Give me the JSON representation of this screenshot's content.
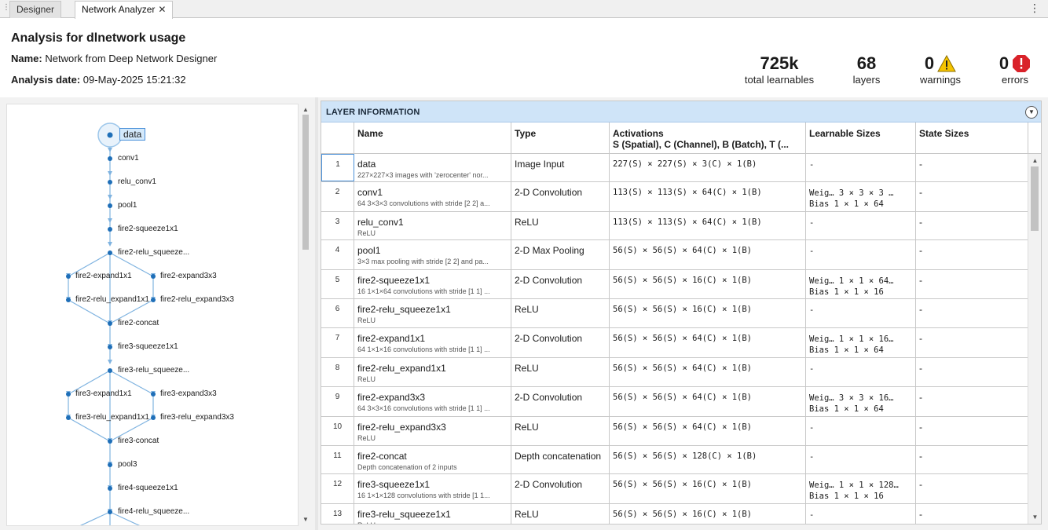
{
  "tabs": [
    {
      "label": "Designer",
      "active": false
    },
    {
      "label": "Network Analyzer",
      "active": true,
      "closable": true
    }
  ],
  "header": {
    "title": "Analysis for dlnetwork usage",
    "name_label": "Name:",
    "name_value": "Network from Deep Network Designer",
    "date_label": "Analysis date:",
    "date_value": "09-May-2025 15:21:32"
  },
  "stats": {
    "learnables": {
      "value": "725k",
      "label": "total learnables"
    },
    "layers": {
      "value": "68",
      "label": "layers"
    },
    "warnings": {
      "value": "0",
      "label": "warnings",
      "icon": "warning-icon",
      "color": "#f5c400"
    },
    "errors": {
      "value": "0",
      "label": "errors",
      "icon": "error-icon",
      "color": "#d9222a"
    }
  },
  "graph": {
    "selected": "data",
    "nodes": [
      "data",
      "conv1",
      "relu_conv1",
      "pool1",
      "fire2-squeeze1x1",
      "fire2-relu_squeeze...",
      "fire2-expand1x1",
      "fire2-expand3x3",
      "fire2-relu_expand1x1",
      "fire2-relu_expand3x3",
      "fire2-concat",
      "fire3-squeeze1x1",
      "fire3-relu_squeeze...",
      "fire3-expand1x1",
      "fire3-expand3x3",
      "fire3-relu_expand1x1",
      "fire3-relu_expand3x3",
      "fire3-concat",
      "pool3",
      "fire4-squeeze1x1",
      "fire4-relu_squeeze..."
    ],
    "accent": "#2b7bc1"
  },
  "table": {
    "title": "LAYER INFORMATION",
    "columns": {
      "name": "Name",
      "type": "Type",
      "activations": "Activations",
      "activations_sub": "S (Spatial), C (Channel), B (Batch), T (...",
      "learnable": "Learnable Sizes",
      "state": "State Sizes"
    },
    "rows": [
      {
        "idx": "1",
        "name": "data",
        "desc": "227×227×3 images with 'zerocenter' nor...",
        "type": "Image Input",
        "act": "227(S) × 227(S) × 3(C) × 1(B)",
        "learn1": "-",
        "learn2": "",
        "state": "-"
      },
      {
        "idx": "2",
        "name": "conv1",
        "desc": "64 3×3×3 convolutions with stride [2 2] a...",
        "type": "2-D Convolution",
        "act": "113(S) × 113(S) × 64(C) × 1(B)",
        "learn1": "Weig…  3 × 3 × 3 …",
        "learn2": "Bias   1 × 1 × 64",
        "state": "-"
      },
      {
        "idx": "3",
        "name": "relu_conv1",
        "desc": "ReLU",
        "type": "ReLU",
        "act": "113(S) × 113(S) × 64(C) × 1(B)",
        "learn1": "-",
        "learn2": "",
        "state": "-"
      },
      {
        "idx": "4",
        "name": "pool1",
        "desc": "3×3 max pooling with stride [2 2] and pa...",
        "type": "2-D Max Pooling",
        "act": "56(S) × 56(S) × 64(C) × 1(B)",
        "learn1": "-",
        "learn2": "",
        "state": "-"
      },
      {
        "idx": "5",
        "name": "fire2-squeeze1x1",
        "desc": "16 1×1×64 convolutions with stride [1 1] ...",
        "type": "2-D Convolution",
        "act": "56(S) × 56(S) × 16(C) × 1(B)",
        "learn1": "Weig…  1 × 1 × 64…",
        "learn2": "Bias   1 × 1 × 16",
        "state": "-"
      },
      {
        "idx": "6",
        "name": "fire2-relu_squeeze1x1",
        "desc": "ReLU",
        "type": "ReLU",
        "act": "56(S) × 56(S) × 16(C) × 1(B)",
        "learn1": "-",
        "learn2": "",
        "state": "-"
      },
      {
        "idx": "7",
        "name": "fire2-expand1x1",
        "desc": "64 1×1×16 convolutions with stride [1 1] ...",
        "type": "2-D Convolution",
        "act": "56(S) × 56(S) × 64(C) × 1(B)",
        "learn1": "Weig…  1 × 1 × 16…",
        "learn2": "Bias   1 × 1 × 64",
        "state": "-"
      },
      {
        "idx": "8",
        "name": "fire2-relu_expand1x1",
        "desc": "ReLU",
        "type": "ReLU",
        "act": "56(S) × 56(S) × 64(C) × 1(B)",
        "learn1": "-",
        "learn2": "",
        "state": "-"
      },
      {
        "idx": "9",
        "name": "fire2-expand3x3",
        "desc": "64 3×3×16 convolutions with stride [1 1] ...",
        "type": "2-D Convolution",
        "act": "56(S) × 56(S) × 64(C) × 1(B)",
        "learn1": "Weig…  3 × 3 × 16…",
        "learn2": "Bias   1 × 1 × 64",
        "state": "-"
      },
      {
        "idx": "10",
        "name": "fire2-relu_expand3x3",
        "desc": "ReLU",
        "type": "ReLU",
        "act": "56(S) × 56(S) × 64(C) × 1(B)",
        "learn1": "-",
        "learn2": "",
        "state": "-"
      },
      {
        "idx": "11",
        "name": "fire2-concat",
        "desc": "Depth concatenation of 2 inputs",
        "type": "Depth concatenation",
        "act": "56(S) × 56(S) × 128(C) × 1(B)",
        "learn1": "-",
        "learn2": "",
        "state": "-"
      },
      {
        "idx": "12",
        "name": "fire3-squeeze1x1",
        "desc": "16 1×1×128 convolutions with stride [1 1...",
        "type": "2-D Convolution",
        "act": "56(S) × 56(S) × 16(C) × 1(B)",
        "learn1": "Weig…  1 × 1 × 128…",
        "learn2": "Bias   1 × 1 × 16",
        "state": "-"
      },
      {
        "idx": "13",
        "name": "fire3-relu_squeeze1x1",
        "desc": "ReLU",
        "type": "ReLU",
        "act": "56(S) × 56(S) × 16(C) × 1(B)",
        "learn1": "-",
        "learn2": "",
        "state": "-"
      }
    ]
  }
}
